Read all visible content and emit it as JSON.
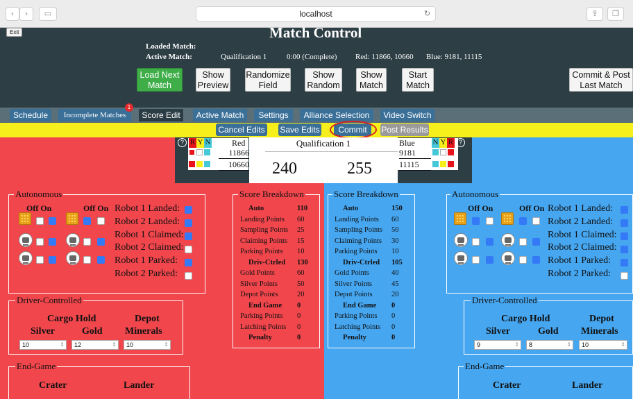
{
  "browser": {
    "url": "localhost"
  },
  "header": {
    "exit": "Exit",
    "title": "Match Control",
    "loaded_label": "Loaded Match:",
    "active_label": "Active Match:",
    "active_match": "Qualification 1",
    "active_time": "0:00 (Complete)",
    "active_red": "Red: 11866, 10660",
    "active_blue": "Blue: 9181, 11115"
  },
  "buttons": {
    "load_next": "Load Next Match",
    "show_preview": "Show Preview",
    "randomize": "Randomize Field",
    "show_random": "Show Random",
    "show_match": "Show Match",
    "start_match": "Start Match",
    "commit_post": "Commit & Post Last Match"
  },
  "tabs": {
    "schedule": "Schedule",
    "incomplete": "Incomplete Matches",
    "incomplete_badge": "1",
    "score_edit": "Score Edit",
    "active_match": "Active Match",
    "settings": "Settings",
    "alliance": "Alliance Selection",
    "video": "Video Switch"
  },
  "subbar": {
    "cancel": "Cancel Edits",
    "save": "Save Edits",
    "commit": "Commit",
    "post": "Post Results"
  },
  "scoreboard": {
    "help": "?",
    "hdr": [
      "R",
      "Y",
      "N",
      "N",
      "Y",
      "R"
    ],
    "red_label": "Red",
    "red_teams": [
      "11866",
      "10660"
    ],
    "blue_label": "Blue",
    "blue_teams": [
      "9181",
      "11115"
    ],
    "match_name": "Qualification 1",
    "red_score": "240",
    "blue_score": "255"
  },
  "auto": {
    "legend": "Autonomous",
    "offon": "Off On",
    "labels": [
      "Robot 1 Landed:",
      "Robot 2 Landed:",
      "Robot 1 Claimed:",
      "Robot 2 Claimed:",
      "Robot 1 Parked:",
      "Robot 2 Parked:"
    ]
  },
  "driver": {
    "legend": "Driver-Controlled",
    "cargo": "Cargo Hold",
    "depot": "Depot",
    "silver": "Silver",
    "gold": "Gold",
    "minerals": "Minerals"
  },
  "red_inputs": {
    "silver": "10",
    "gold": "12",
    "depot": "10"
  },
  "blue_inputs": {
    "silver": "9",
    "gold": "8",
    "depot": "10"
  },
  "endgame": {
    "legend": "End-Game",
    "crater": "Crater",
    "lander": "Lander"
  },
  "breakdown": {
    "legend": "Score Breakdown",
    "red": [
      [
        "Auto",
        "110"
      ],
      [
        "Landing Points",
        "60"
      ],
      [
        "Sampling Points",
        "25"
      ],
      [
        "Claiming Points",
        "15"
      ],
      [
        "Parking Points",
        "10"
      ],
      [
        "Driv-Ctrled",
        "130"
      ],
      [
        "Gold Points",
        "60"
      ],
      [
        "Silver Points",
        "50"
      ],
      [
        "Depot Points",
        "20"
      ],
      [
        "End Game",
        "0"
      ],
      [
        "Parking Points",
        "0"
      ],
      [
        "Latching Points",
        "0"
      ],
      [
        "Penalty",
        "0"
      ]
    ],
    "blue": [
      [
        "Auto",
        "150"
      ],
      [
        "Landing Points",
        "60"
      ],
      [
        "Sampling Points",
        "50"
      ],
      [
        "Claiming Points",
        "30"
      ],
      [
        "Parking Points",
        "10"
      ],
      [
        "Driv-Ctrled",
        "105"
      ],
      [
        "Gold Points",
        "40"
      ],
      [
        "Silver Points",
        "45"
      ],
      [
        "Depot Points",
        "20"
      ],
      [
        "End Game",
        "0"
      ],
      [
        "Parking Points",
        "0"
      ],
      [
        "Latching Points",
        "0"
      ],
      [
        "Penalty",
        "0"
      ]
    ]
  }
}
